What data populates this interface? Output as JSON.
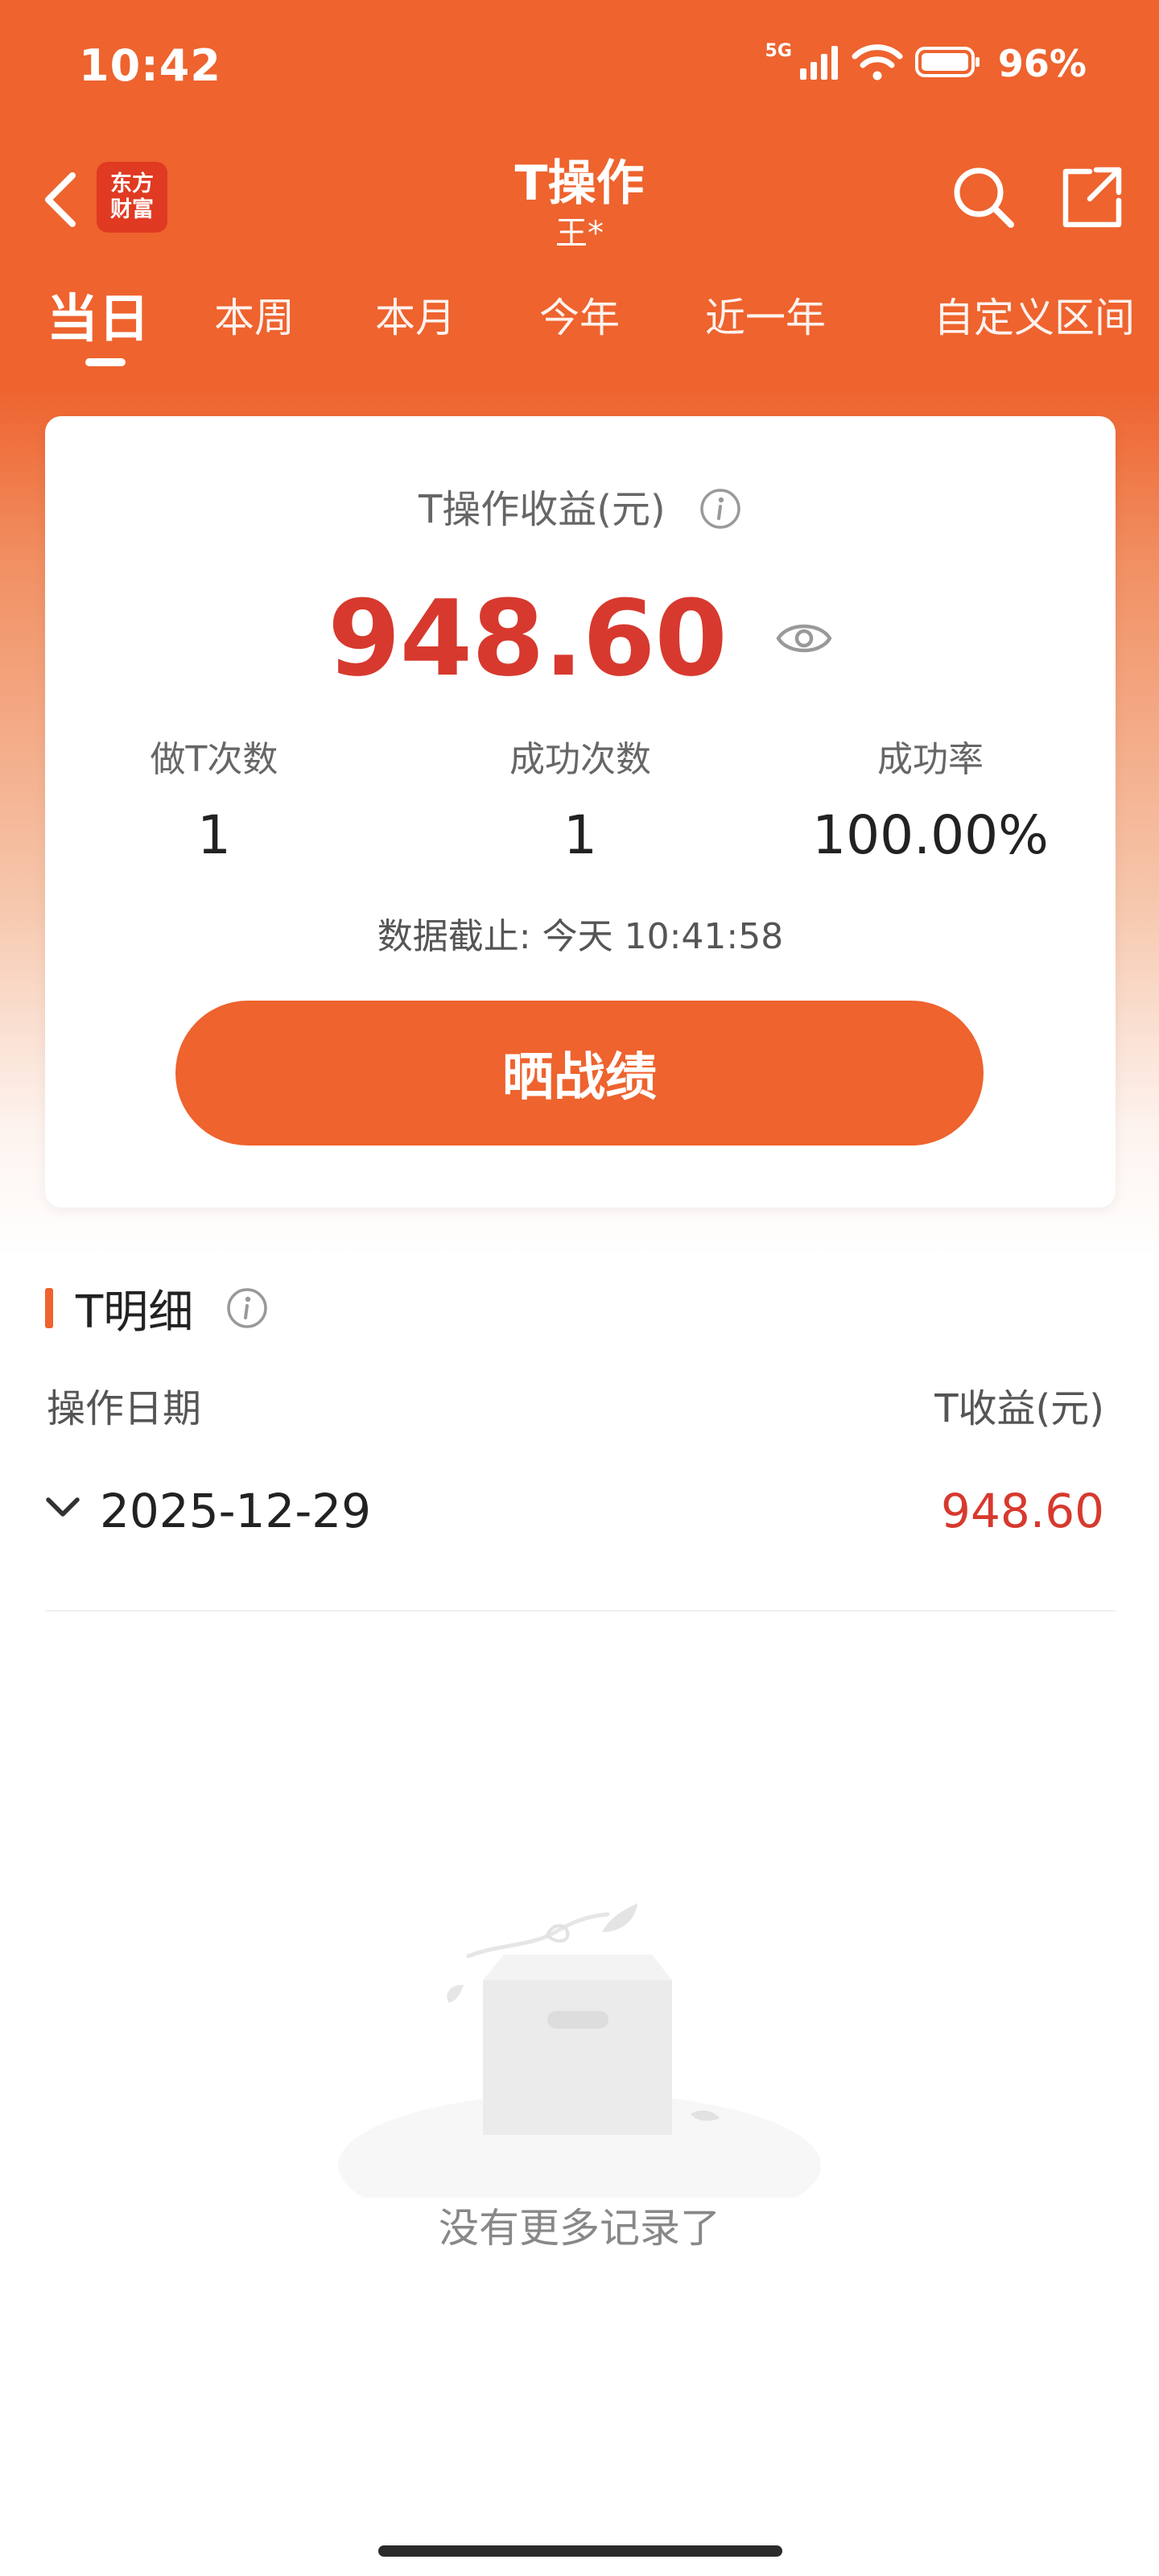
{
  "status_bar": {
    "time": "10:42",
    "network": "5G",
    "battery": "96%"
  },
  "nav": {
    "brand_line1": "东方",
    "brand_line2": "财富",
    "title": "T操作",
    "subtitle": "王*"
  },
  "tabs": [
    {
      "label": "当日",
      "active": true
    },
    {
      "label": "本周",
      "active": false
    },
    {
      "label": "本月",
      "active": false
    },
    {
      "label": "今年",
      "active": false
    },
    {
      "label": "近一年",
      "active": false
    },
    {
      "label": "自定义区间",
      "active": false
    }
  ],
  "summary": {
    "label": "T操作收益(元)",
    "value": "948.60",
    "stats": [
      {
        "label": "做T次数",
        "value": "1"
      },
      {
        "label": "成功次数",
        "value": "1"
      },
      {
        "label": "成功率",
        "value": "100.00%"
      }
    ],
    "data_time": "数据截止: 今天 10:41:58",
    "share_button": "晒战绩"
  },
  "detail": {
    "title": "T明细",
    "col_left": "操作日期",
    "col_right": "T收益(元)",
    "rows": [
      {
        "date": "2025-12-29",
        "value": "948.60"
      }
    ],
    "empty_text": "没有更多记录了"
  },
  "colors": {
    "brand_orange": "#EE632E",
    "profit_red": "#D7392E"
  }
}
